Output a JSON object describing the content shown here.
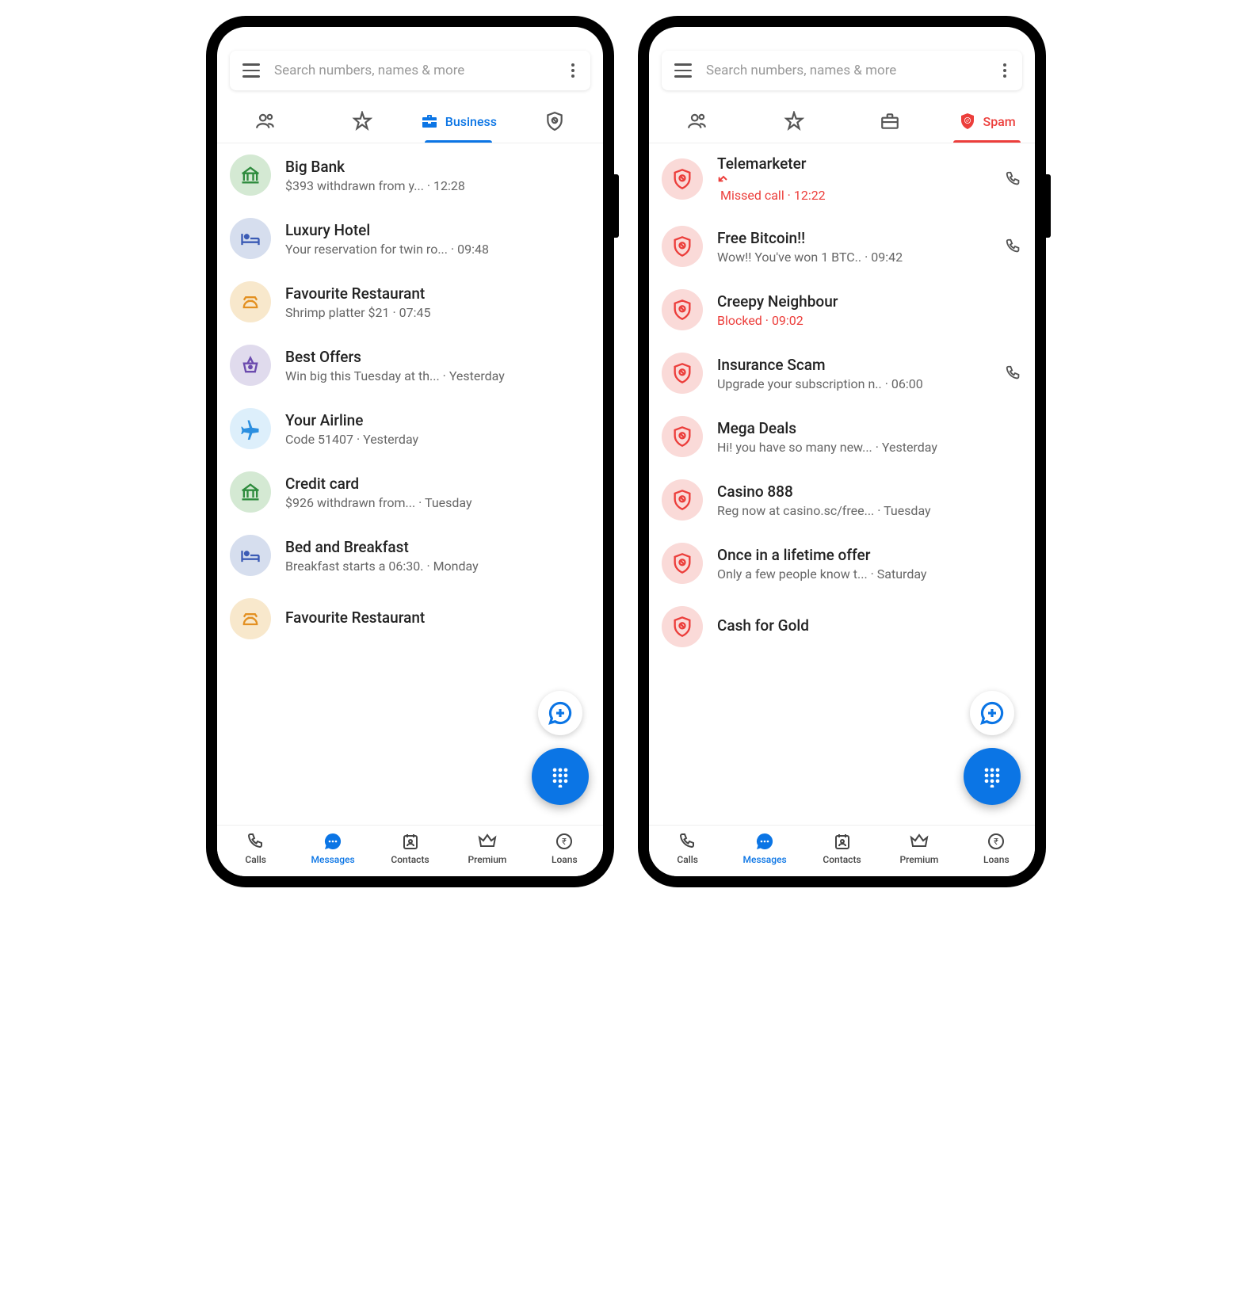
{
  "search": {
    "placeholder": "Search numbers, names & more"
  },
  "tabs": {
    "business": "Business",
    "spam": "Spam"
  },
  "phone1": {
    "items": [
      {
        "title": "Big Bank",
        "sub": "$393 withdrawn from y... · 12:28",
        "icon": "bank",
        "bg": "green"
      },
      {
        "title": "Luxury Hotel",
        "sub": "Your reservation for twin ro... · 09:48",
        "icon": "hotel",
        "bg": "blue"
      },
      {
        "title": "Favourite Restaurant",
        "sub": "Shrimp platter $21 · 07:45",
        "icon": "food",
        "bg": "orange"
      },
      {
        "title": "Best Offers",
        "sub": "Win big this Tuesday at th... · Yesterday",
        "icon": "basket",
        "bg": "purple"
      },
      {
        "title": "Your Airline",
        "sub": "Code 51407 · Yesterday",
        "icon": "plane",
        "bg": "lightblue"
      },
      {
        "title": "Credit card",
        "sub": "$926 withdrawn from... · Tuesday",
        "icon": "bank",
        "bg": "green"
      },
      {
        "title": "Bed and Breakfast",
        "sub": "Breakfast starts a 06:30. · Monday",
        "icon": "hotel",
        "bg": "blue"
      },
      {
        "title": "Favourite Restaurant",
        "sub": "",
        "icon": "food",
        "bg": "orange"
      }
    ]
  },
  "phone2": {
    "items": [
      {
        "title": "Telemarketer",
        "sub": "Missed call · 12:22",
        "red": true,
        "call": true,
        "missed": true
      },
      {
        "title": "Free Bitcoin!!",
        "sub": "Wow!! You've won 1 BTC.. · 09:42",
        "call": true
      },
      {
        "title": "Creepy Neighbour",
        "sub": "Blocked · 09:02",
        "red": true
      },
      {
        "title": "Insurance Scam",
        "sub": "Upgrade your subscription n.. · 06:00",
        "call": true
      },
      {
        "title": "Mega Deals",
        "sub": "Hi! you have so many new... · Yesterday"
      },
      {
        "title": "Casino 888",
        "sub": "Reg now at casino.sc/free... · Tuesday"
      },
      {
        "title": "Once in a lifetime offer",
        "sub": "Only a few people know t... · Saturday"
      },
      {
        "title": "Cash for Gold",
        "sub": ""
      }
    ]
  },
  "nav": {
    "calls": "Calls",
    "messages": "Messages",
    "contacts": "Contacts",
    "premium": "Premium",
    "loans": "Loans"
  }
}
